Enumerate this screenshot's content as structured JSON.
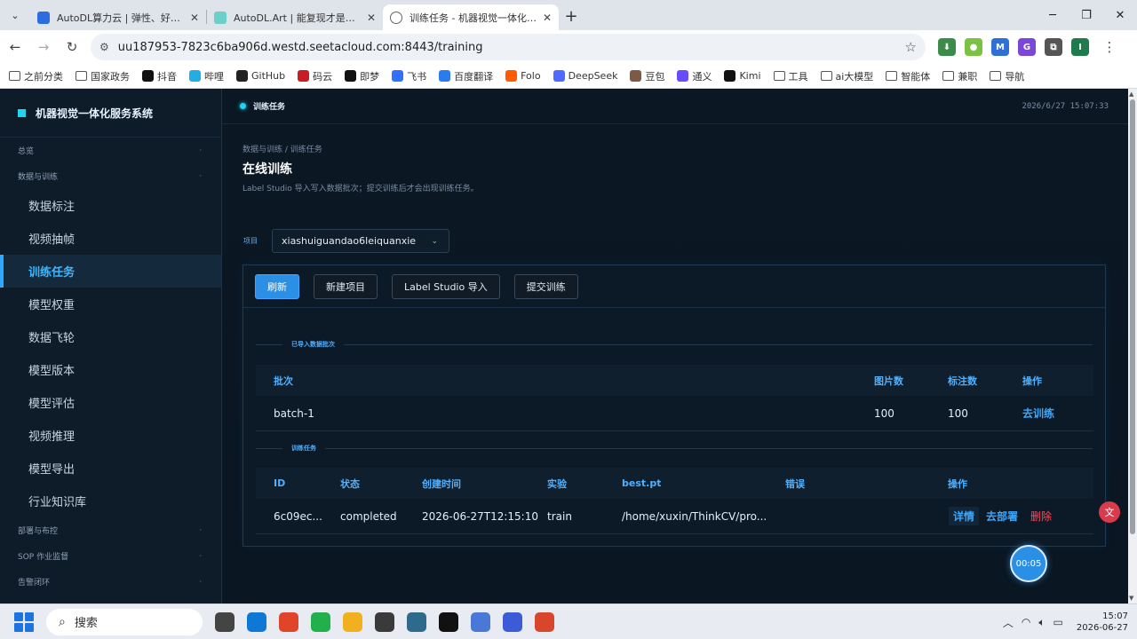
{
  "browser": {
    "tabs": [
      {
        "title": "AutoDL算力云 | 弹性、好用、省",
        "color": "#2b6de0",
        "active": false
      },
      {
        "title": "AutoDL.Art | 能复现才是好算法",
        "color": "#6ad0c9",
        "active": false
      },
      {
        "title": "训练任务 - 机器视觉一体化服务系统",
        "color": "#666666",
        "active": true
      }
    ],
    "url": "uu187953-7823c6ba906d.westd.seetacloud.com:8443/training",
    "bookmarks": [
      {
        "label": "之前分类",
        "kind": "folder"
      },
      {
        "label": "国家政务",
        "kind": "folder"
      },
      {
        "label": "抖音",
        "kind": "app",
        "color": "#111111"
      },
      {
        "label": "哔哩",
        "kind": "app",
        "color": "#23ade5"
      },
      {
        "label": "GitHub",
        "kind": "app",
        "color": "#222222"
      },
      {
        "label": "码云",
        "kind": "app",
        "color": "#c71d23"
      },
      {
        "label": "即梦",
        "kind": "app",
        "color": "#111111"
      },
      {
        "label": "飞书",
        "kind": "app",
        "color": "#3370ff"
      },
      {
        "label": "百度翻译",
        "kind": "app",
        "color": "#2b7bf0"
      },
      {
        "label": "Folo",
        "kind": "app",
        "color": "#ff5c00"
      },
      {
        "label": "DeepSeek",
        "kind": "app",
        "color": "#4d6bfe"
      },
      {
        "label": "豆包",
        "kind": "app",
        "color": "#7d5a45"
      },
      {
        "label": "通义",
        "kind": "app",
        "color": "#6a4cff"
      },
      {
        "label": "Kimi",
        "kind": "app",
        "color": "#111111"
      },
      {
        "label": "工具",
        "kind": "folder"
      },
      {
        "label": "ai大模型",
        "kind": "folder"
      },
      {
        "label": "智能体",
        "kind": "folder"
      },
      {
        "label": "兼职",
        "kind": "folder"
      },
      {
        "label": "导航",
        "kind": "folder"
      }
    ],
    "extensions": [
      {
        "label": "⬇",
        "color": "#3c8b4a"
      },
      {
        "label": "●",
        "color": "#7cc242"
      },
      {
        "label": "M",
        "color": "#2f6fd6"
      },
      {
        "label": "G",
        "color": "#7a47d9"
      },
      {
        "label": "⧉",
        "color": "#555555"
      },
      {
        "label": "I",
        "color": "#1f7a4d"
      }
    ]
  },
  "app": {
    "brand": "机器视觉一体化服务系统",
    "sidebar": {
      "groups": [
        {
          "label": "总览",
          "items": []
        },
        {
          "label": "数据与训练",
          "items": [
            "数据标注",
            "视频抽帧",
            "训练任务",
            "模型权重",
            "数据飞轮",
            "模型版本",
            "模型评估",
            "视频推理",
            "模型导出",
            "行业知识库"
          ]
        },
        {
          "label": "部署与布控",
          "items": []
        },
        {
          "label": "SOP 作业监督",
          "items": []
        },
        {
          "label": "告警闭环",
          "items": []
        }
      ],
      "active": "训练任务"
    },
    "topbar": {
      "current": "训练任务",
      "time": "2026/6/27 15:07:33"
    },
    "breadcrumb": "数据与训练 / 训练任务",
    "page_title": "在线训练",
    "page_subtitle": "Label Studio 导入写入数据批次；提交训练后才会出现训练任务。",
    "project_label": "项目",
    "project_value": "xiashuiguandao6leiquanxie",
    "buttons": {
      "refresh": "刷新",
      "new_project": "新建项目",
      "ls_import": "Label Studio 导入",
      "submit": "提交训练"
    },
    "batches": {
      "section": "已导入数据批次",
      "headers": {
        "batch": "批次",
        "images": "图片数",
        "labels": "标注数",
        "action": "操作"
      },
      "rows": [
        {
          "batch": "batch-1",
          "images": "100",
          "labels": "100",
          "action": "去训练"
        }
      ]
    },
    "jobs": {
      "section": "训练任务",
      "headers": {
        "id": "ID",
        "status": "状态",
        "created": "创建时间",
        "experiment": "实验",
        "best": "best.pt",
        "error": "错误",
        "action": "操作"
      },
      "rows": [
        {
          "id": "6c09ec...",
          "status": "completed",
          "created": "2026-06-27T12:15:10",
          "experiment": "train",
          "best": "/home/xuxin/ThinkCV/pro...",
          "error": "",
          "detail": "详情",
          "deploy": "去部署",
          "delete": "删除"
        }
      ]
    },
    "timer": "00:05"
  },
  "taskbar": {
    "search": "搜索",
    "time": "15:07",
    "date": "2026-06-27",
    "apps": [
      "#444444",
      "#0f78d4",
      "#e0452a",
      "#21b04b",
      "#f2b01e",
      "#3a3a3a",
      "#2d6a8c",
      "#111111",
      "#4a78d6",
      "#3d5bd6",
      "#d8462b"
    ]
  }
}
